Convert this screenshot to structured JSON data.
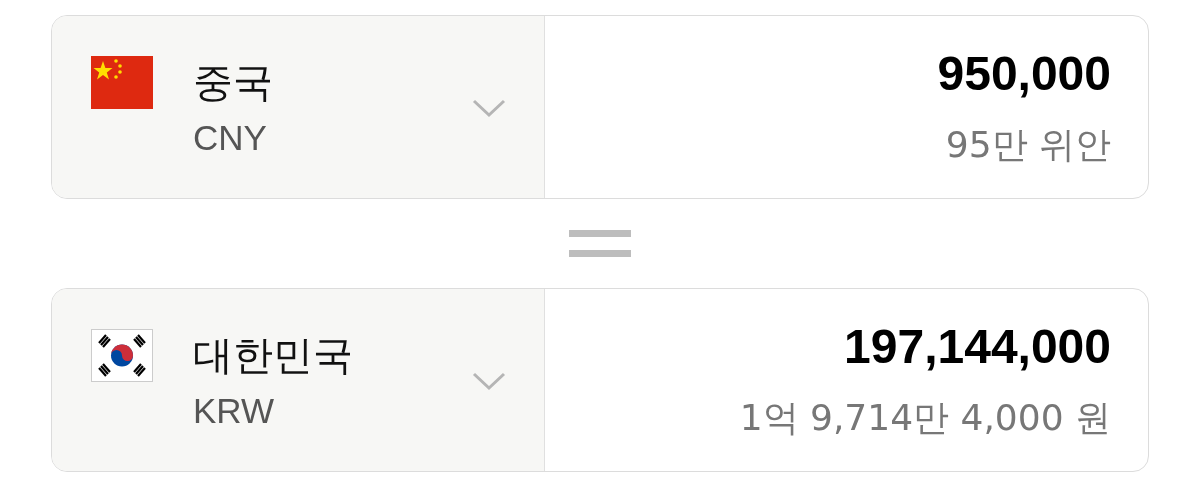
{
  "converters": [
    {
      "kind": "cn",
      "country": "중국",
      "code": "CNY",
      "amount": "950,000",
      "amount_words": "95만 위안"
    },
    {
      "kind": "kr",
      "country": "대한민국",
      "code": "KRW",
      "amount": "197,144,000",
      "amount_words": "1억 9,714만 4,000 원"
    }
  ]
}
